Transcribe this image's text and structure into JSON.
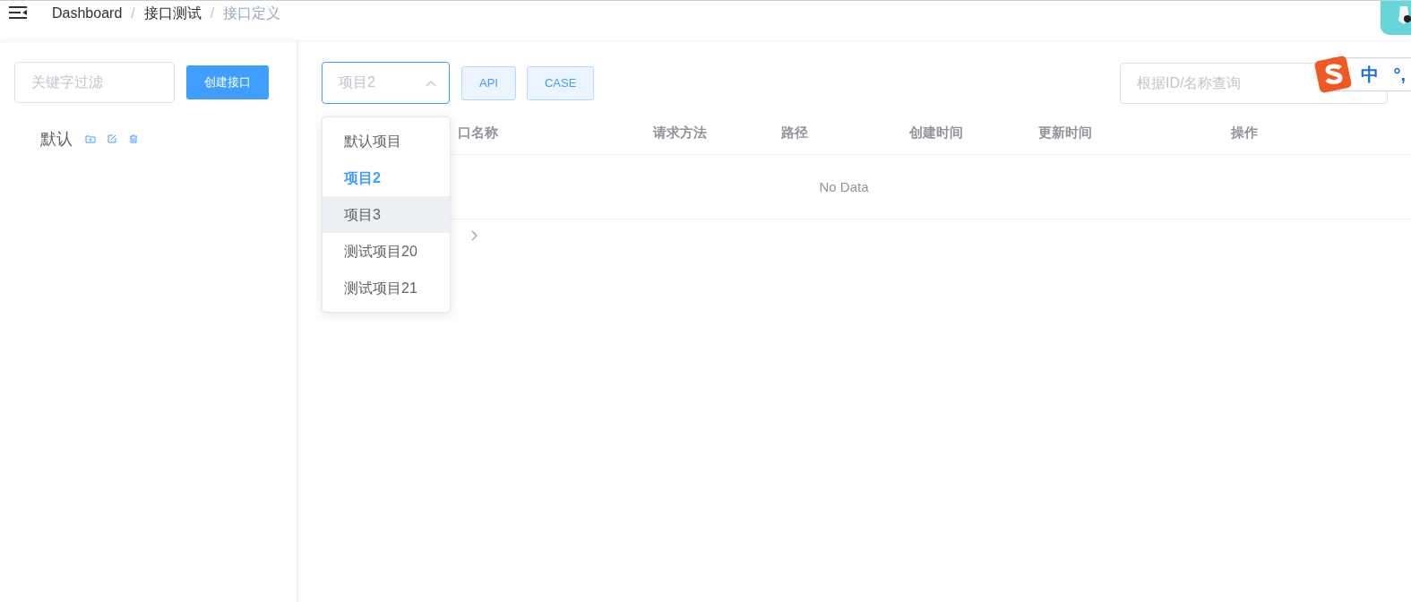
{
  "header": {
    "breadcrumb": [
      {
        "kind": "link",
        "text": "Dashboard"
      },
      {
        "kind": "separator",
        "text": "/"
      },
      {
        "kind": "link",
        "text": "接口测试"
      },
      {
        "kind": "separator",
        "text": "/"
      },
      {
        "kind": "current",
        "text": "接口定义"
      }
    ]
  },
  "sidebar": {
    "filter": {
      "placeholder": "关键字过滤"
    },
    "create_button": "创建接口",
    "tree": [
      {
        "label": "默认"
      }
    ]
  },
  "main": {
    "project_select": {
      "placeholder": "项目2",
      "expanded": true,
      "options": [
        {
          "label": "默认项目",
          "selected": false,
          "hovered": false
        },
        {
          "label": "项目2",
          "selected": true,
          "hovered": false
        },
        {
          "label": "项目3",
          "selected": false,
          "hovered": true
        },
        {
          "label": "测试项目20",
          "selected": false,
          "hovered": false
        },
        {
          "label": "测试项目21",
          "selected": false,
          "hovered": false
        }
      ]
    },
    "type_buttons": [
      "API",
      "CASE"
    ],
    "search": {
      "placeholder": "根据ID/名称查询"
    },
    "table": {
      "columns": [
        "口名称",
        "请求方法",
        "路径",
        "创建时间",
        "更新时间",
        "操作"
      ],
      "empty_text": "No Data"
    }
  },
  "ime_bar": {
    "mode": "中",
    "punctuation": "°,"
  }
}
